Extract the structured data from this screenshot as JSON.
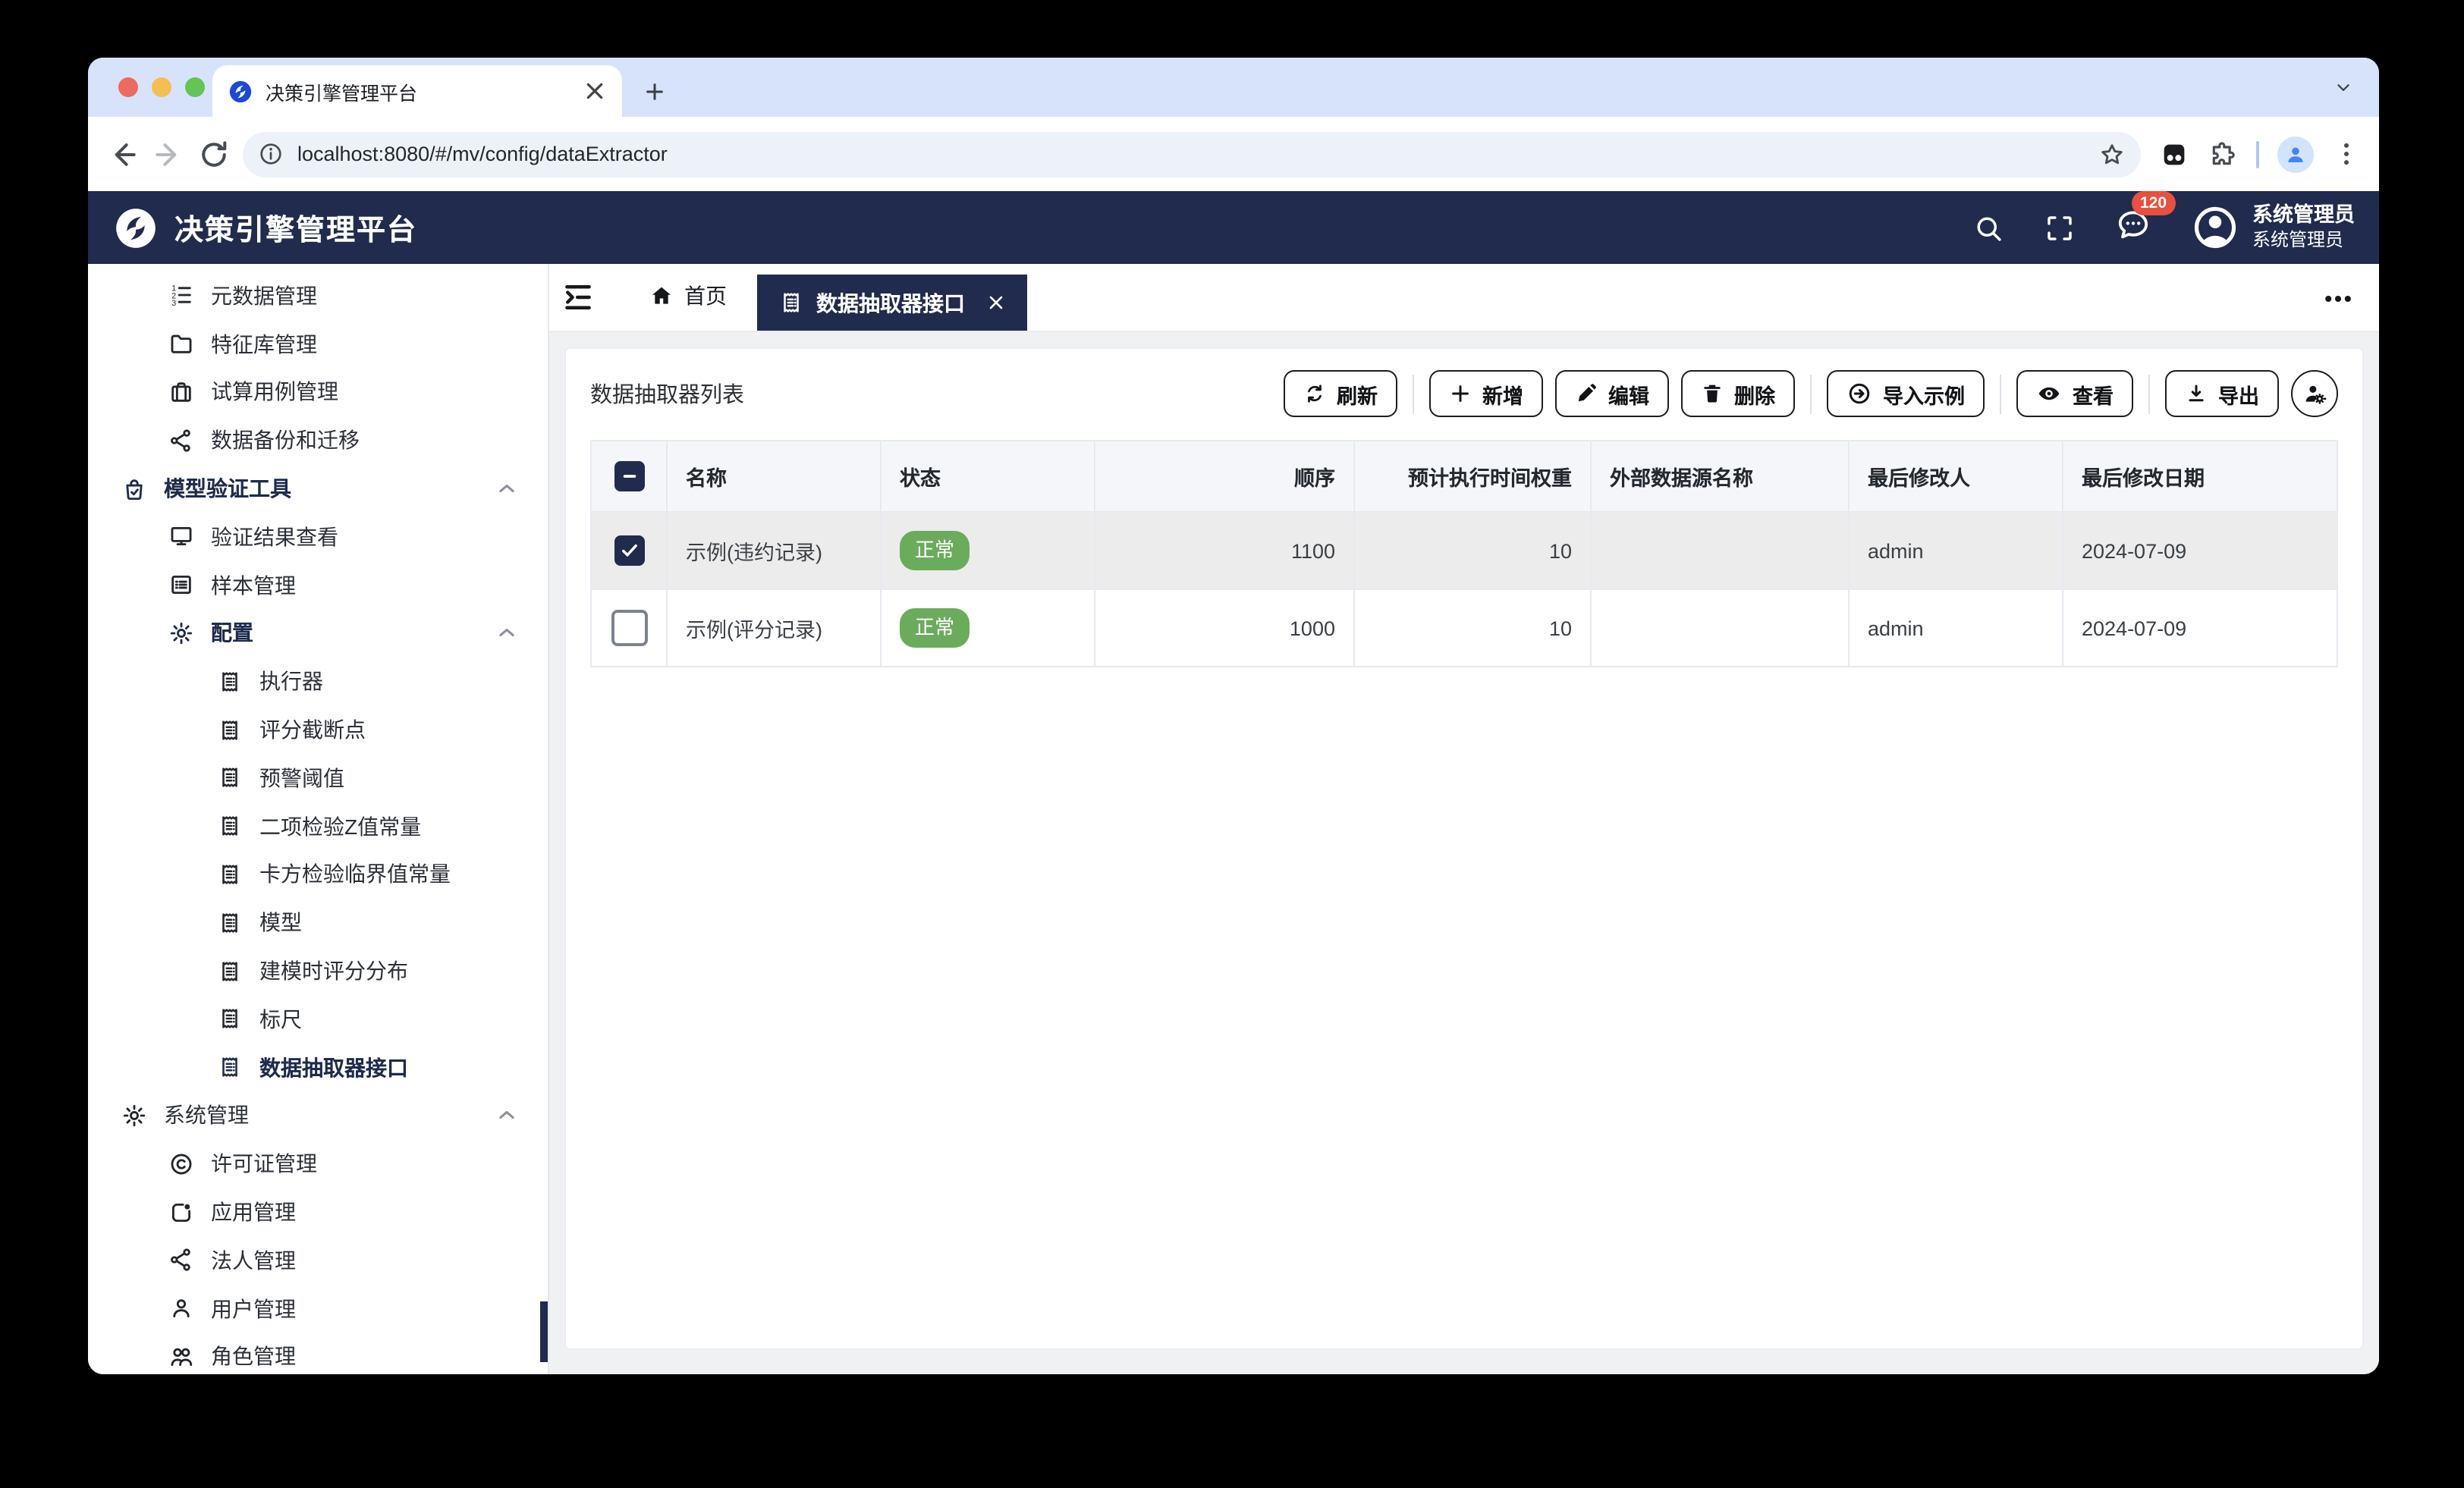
{
  "browser": {
    "tab_title": "决策引擎管理平台",
    "url": "localhost:8080/#/mv/config/dataExtractor"
  },
  "app_header": {
    "title": "决策引擎管理平台",
    "badge_count": "120",
    "user_name": "系统管理员",
    "user_role": "系统管理员"
  },
  "sidebar": {
    "items": [
      {
        "label": "元数据管理",
        "icon": "ordered-list",
        "level": 1
      },
      {
        "label": "特征库管理",
        "icon": "folder",
        "level": 1
      },
      {
        "label": "试算用例管理",
        "icon": "suitcase",
        "level": 1
      },
      {
        "label": "数据备份和迁移",
        "icon": "share",
        "level": 1
      },
      {
        "label": "模型验证工具",
        "icon": "bag-check",
        "level": 0,
        "bold": true,
        "expanded": true
      },
      {
        "label": "验证结果查看",
        "icon": "monitor",
        "level": 1
      },
      {
        "label": "样本管理",
        "icon": "list-box",
        "level": 1
      },
      {
        "label": "配置",
        "icon": "gear",
        "level": 1,
        "bold": true,
        "expanded": true
      },
      {
        "label": "执行器",
        "icon": "receipt",
        "level": 2
      },
      {
        "label": "评分截断点",
        "icon": "receipt",
        "level": 2
      },
      {
        "label": "预警阈值",
        "icon": "receipt",
        "level": 2
      },
      {
        "label": "二项检验Z值常量",
        "icon": "receipt",
        "level": 2
      },
      {
        "label": "卡方检验临界值常量",
        "icon": "receipt",
        "level": 2
      },
      {
        "label": "模型",
        "icon": "receipt",
        "level": 2
      },
      {
        "label": "建模时评分分布",
        "icon": "receipt",
        "level": 2
      },
      {
        "label": "标尺",
        "icon": "receipt",
        "level": 2
      },
      {
        "label": "数据抽取器接口",
        "icon": "receipt",
        "level": 2,
        "selected": true
      },
      {
        "label": "系统管理",
        "icon": "gear",
        "level": 0,
        "expanded": true
      },
      {
        "label": "许可证管理",
        "icon": "copyright",
        "level": 1
      },
      {
        "label": "应用管理",
        "icon": "app",
        "level": 1
      },
      {
        "label": "法人管理",
        "icon": "share",
        "level": 1
      },
      {
        "label": "用户管理",
        "icon": "user",
        "level": 1
      },
      {
        "label": "角色管理",
        "icon": "users",
        "level": 1
      }
    ]
  },
  "tabs": {
    "home_label": "首页",
    "active_label": "数据抽取器接口"
  },
  "main": {
    "list_title": "数据抽取器列表",
    "buttons": {
      "refresh": "刷新",
      "add": "新增",
      "edit": "编辑",
      "delete": "删除",
      "import_sample": "导入示例",
      "view": "查看",
      "export": "导出"
    },
    "table": {
      "headers": [
        "名称",
        "状态",
        "顺序",
        "预计执行时间权重",
        "外部数据源名称",
        "最后修改人",
        "最后修改日期"
      ],
      "rows": [
        {
          "checked": true,
          "name": "示例(违约记录)",
          "status": "正常",
          "order": "1100",
          "weight": "10",
          "datasource": "",
          "modified_by": "admin",
          "modified_date": "2024-07-09"
        },
        {
          "checked": false,
          "name": "示例(评分记录)",
          "status": "正常",
          "order": "1000",
          "weight": "10",
          "datasource": "",
          "modified_by": "admin",
          "modified_date": "2024-07-09"
        }
      ]
    }
  },
  "colors": {
    "navy": "#202b4d",
    "status_green": "#6bab5c",
    "badge_red": "#e8503f",
    "tabstrip": "#d7e3fb",
    "selected_row": "#ececec"
  }
}
